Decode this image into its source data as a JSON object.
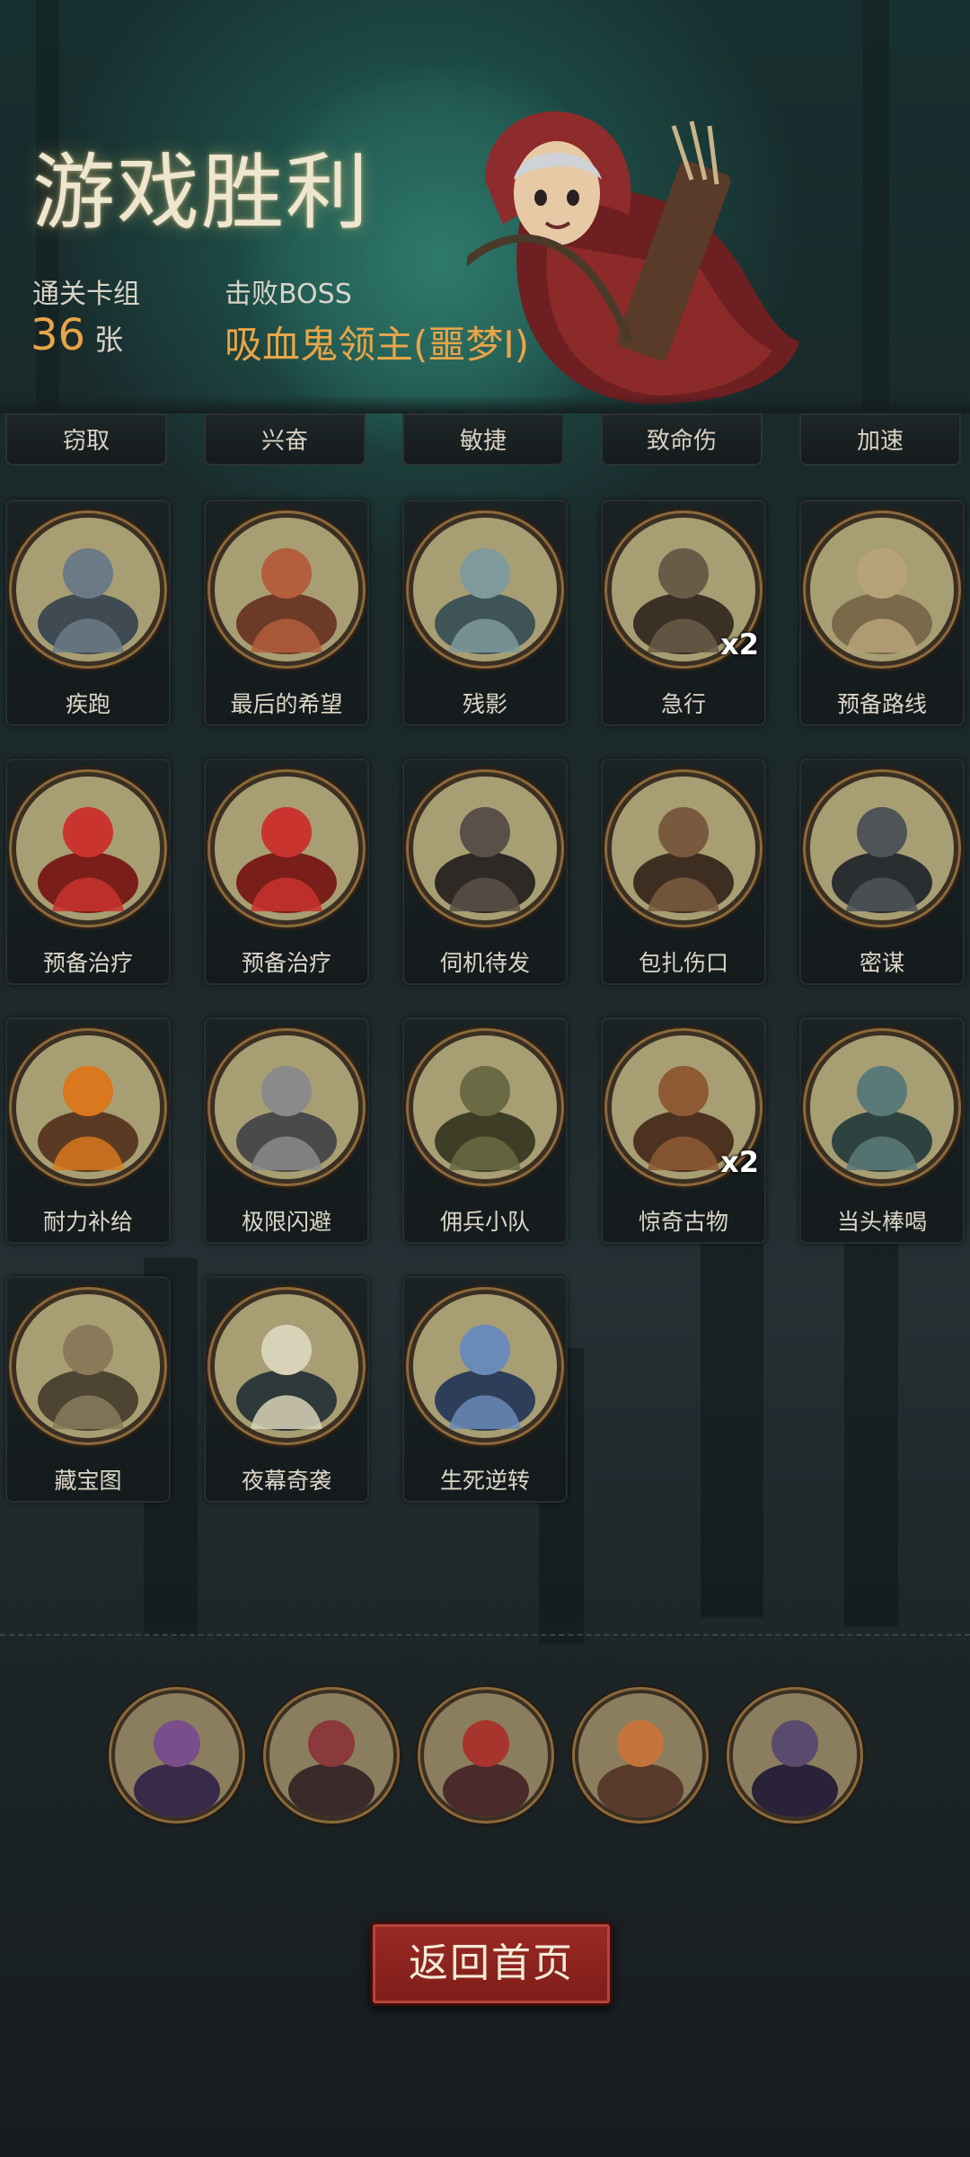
{
  "header": {
    "title": "游戏胜利",
    "deck_label": "通关卡组",
    "deck_count": "36",
    "deck_unit": "张",
    "boss_label": "击败BOSS",
    "boss_name": "吸血鬼领主(噩梦I)"
  },
  "cut_row": [
    "窃取",
    "兴奋",
    "敏捷",
    "致命伤",
    "加速"
  ],
  "cards": [
    {
      "label": "疾跑",
      "icon": "running-beast-icon"
    },
    {
      "label": "最后的希望",
      "icon": "girl-portrait-icon"
    },
    {
      "label": "残影",
      "icon": "afterimage-icon"
    },
    {
      "label": "急行",
      "icon": "rushing-traveler-icon",
      "mult": "x2"
    },
    {
      "label": "预备路线",
      "icon": "map-route-icon"
    },
    {
      "label": "预备治疗",
      "icon": "heart-heal-icon"
    },
    {
      "label": "预备治疗",
      "icon": "heart-heal-icon"
    },
    {
      "label": "伺机待发",
      "icon": "masked-assassin-icon"
    },
    {
      "label": "包扎伤口",
      "icon": "plague-doctor-icon"
    },
    {
      "label": "密谋",
      "icon": "hooded-conspirators-icon"
    },
    {
      "label": "耐力补给",
      "icon": "pumpkin-bird-icon"
    },
    {
      "label": "极限闪避",
      "icon": "dodge-acrobat-icon"
    },
    {
      "label": "佣兵小队",
      "icon": "mercenary-squad-icon"
    },
    {
      "label": "惊奇古物",
      "icon": "explorer-magnifier-icon",
      "mult": "x2"
    },
    {
      "label": "当头棒喝",
      "icon": "girl-hit-zombie-icon"
    },
    {
      "label": "藏宝图",
      "icon": "treasure-map-icon"
    },
    {
      "label": "夜幕奇袭",
      "icon": "night-ambush-icon"
    },
    {
      "label": "生死逆转",
      "icon": "life-death-reversal-icon"
    }
  ],
  "allies": [
    {
      "icon": "witch-portrait-icon"
    },
    {
      "icon": "skull-reaper-icon"
    },
    {
      "icon": "red-wolf-hunter-icon"
    },
    {
      "icon": "redhood-arrow-icon"
    },
    {
      "icon": "black-cat-wizard-icon"
    }
  ],
  "footer": {
    "return_label": "返回首页"
  },
  "colors": {
    "accent_orange": "#e8a548",
    "button_red": "#8b231e",
    "title_cream": "#efe6cf"
  }
}
